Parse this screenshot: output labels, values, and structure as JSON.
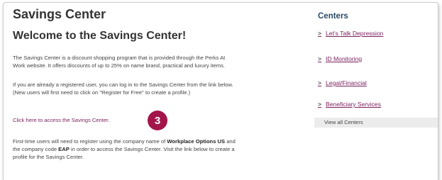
{
  "main": {
    "page_title": "Savings Center",
    "welcome_heading": "Welcome to the Savings Center!",
    "intro_line1": "The Savings Center is a discount shopping program that is provided through the Perks At",
    "intro_line2": "Work website. It offers discounts of up to 25% on name brand, practical and luxury items.",
    "login_line1": "If you are already a registered user, you can log in to the Savings Center from the link below.",
    "login_line2": "(New users will first need to click on \"Register for Free\" to create a profile.)",
    "access_link": "Click here to access the Savings Center.",
    "step_badge": "3",
    "reg_part1": "First-time users will need to register using the company name of ",
    "company_name": "Workplace Options US",
    "reg_part2": " and",
    "reg_part3": "the company code ",
    "company_code": "EAP",
    "reg_part4": " in order to access the Savings Center.  Visit the link below to create a",
    "reg_line3": "profile for the Savings Center."
  },
  "sidebar": {
    "title": "Centers",
    "items": [
      {
        "label": "Let's Talk Depression"
      },
      {
        "label": "ID Monitoring"
      },
      {
        "label": "Legal/Financial"
      },
      {
        "label": "Beneficiary Services"
      }
    ],
    "view_all": "View all Centers"
  },
  "colors": {
    "badge": "#a3154b",
    "link": "#7a1f5c",
    "sidebar_title": "#2a4a66"
  }
}
